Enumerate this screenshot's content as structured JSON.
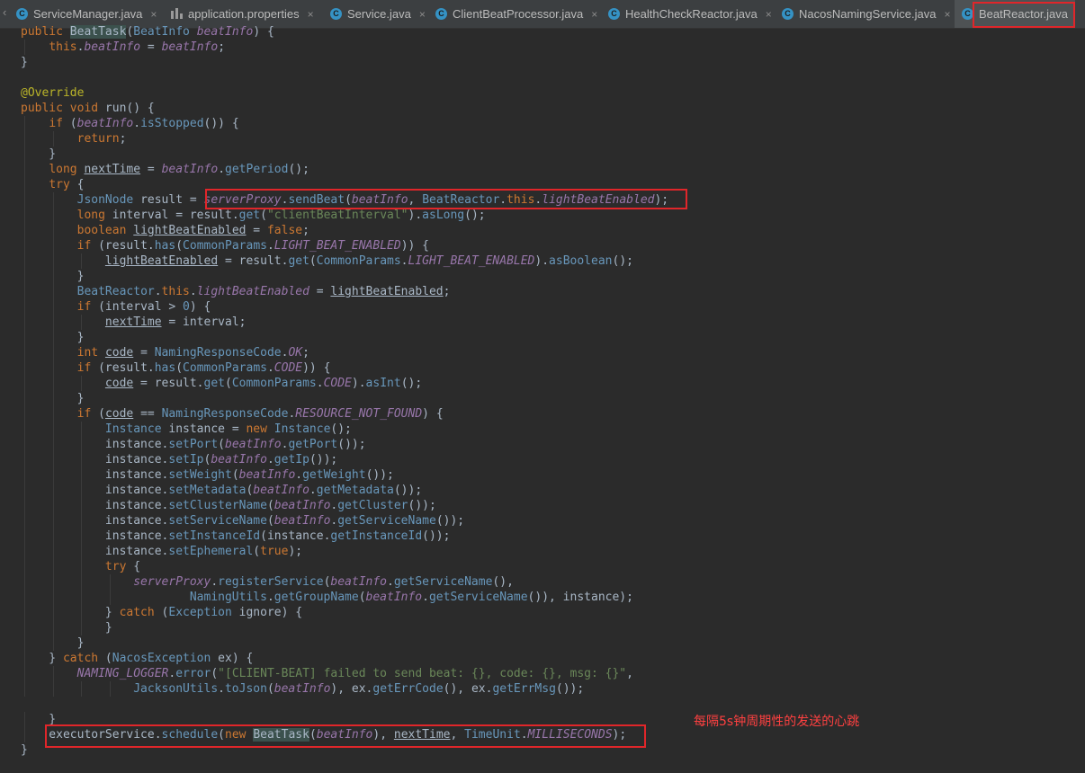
{
  "tabs": [
    {
      "label": "ServiceManager.java",
      "icon": "java-class-icon"
    },
    {
      "label": "application.properties",
      "icon": "properties-file-icon"
    },
    {
      "label": "Service.java",
      "icon": "java-class-icon"
    },
    {
      "label": "ClientBeatProcessor.java",
      "icon": "java-class-icon"
    },
    {
      "label": "HealthCheckReactor.java",
      "icon": "java-class-icon"
    },
    {
      "label": "NacosNamingService.java",
      "icon": "java-class-icon"
    },
    {
      "label": "BeatReactor.java",
      "icon": "java-class-icon",
      "active": true
    }
  ],
  "code_lines": [
    "public BeatTask(BeatInfo beatInfo) {",
    "    this.beatInfo = beatInfo;",
    "}",
    "",
    "@Override",
    "public void run() {",
    "    if (beatInfo.isStopped()) {",
    "        return;",
    "    }",
    "    long nextTime = beatInfo.getPeriod();",
    "    try {",
    "        JsonNode result = serverProxy.sendBeat(beatInfo, BeatReactor.this.lightBeatEnabled);",
    "        long interval = result.get(\"clientBeatInterval\").asLong();",
    "        boolean lightBeatEnabled = false;",
    "        if (result.has(CommonParams.LIGHT_BEAT_ENABLED)) {",
    "            lightBeatEnabled = result.get(CommonParams.LIGHT_BEAT_ENABLED).asBoolean();",
    "        }",
    "        BeatReactor.this.lightBeatEnabled = lightBeatEnabled;",
    "        if (interval > 0) {",
    "            nextTime = interval;",
    "        }",
    "        int code = NamingResponseCode.OK;",
    "        if (result.has(CommonParams.CODE)) {",
    "            code = result.get(CommonParams.CODE).asInt();",
    "        }",
    "        if (code == NamingResponseCode.RESOURCE_NOT_FOUND) {",
    "            Instance instance = new Instance();",
    "            instance.setPort(beatInfo.getPort());",
    "            instance.setIp(beatInfo.getIp());",
    "            instance.setWeight(beatInfo.getWeight());",
    "            instance.setMetadata(beatInfo.getMetadata());",
    "            instance.setClusterName(beatInfo.getCluster());",
    "            instance.setServiceName(beatInfo.getServiceName());",
    "            instance.setInstanceId(instance.getInstanceId());",
    "            instance.setEphemeral(true);",
    "            try {",
    "                serverProxy.registerService(beatInfo.getServiceName(),",
    "                        NamingUtils.getGroupName(beatInfo.getServiceName()), instance);",
    "            } catch (Exception ignore) {",
    "            }",
    "        }",
    "    } catch (NacosException ex) {",
    "        NAMING_LOGGER.error(\"[CLIENT-BEAT] failed to send beat: {}, code: {}, msg: {}\",",
    "                JacksonUtils.toJson(beatInfo), ex.getErrCode(), ex.getErrMsg());",
    "",
    "    }",
    "    executorService.schedule(new BeatTask(beatInfo), nextTime, TimeUnit.MILLISECONDS);",
    "}"
  ],
  "annotation": "每隔5s钟周期性的发送的心跳",
  "colors": {
    "background": "#2b2b2b",
    "keyword": "#cc7832",
    "field": "#9876aa",
    "method": "#6897bb",
    "string": "#6a8759",
    "annotation": "#bbb529",
    "highlight_box": "#e0262a"
  }
}
